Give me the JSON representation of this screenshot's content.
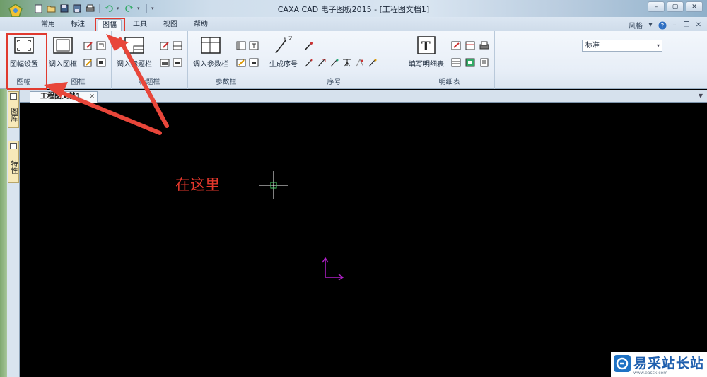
{
  "window": {
    "title": "CAXA CAD 电子图板2015 - [工程图文档1]",
    "style_label": "风格"
  },
  "menu": {
    "tabs": [
      {
        "label": "常用"
      },
      {
        "label": "标注"
      },
      {
        "label": "图幅"
      },
      {
        "label": "工具"
      },
      {
        "label": "视图"
      },
      {
        "label": "帮助"
      }
    ],
    "active_tab": "图幅"
  },
  "ribbon": {
    "frame_group": {
      "label": "图幅",
      "settings_button": "图幅设置"
    },
    "border_group": {
      "label": "图框",
      "load_button": "调入图框"
    },
    "titlebar_group": {
      "label": "标题栏",
      "load_button": "调入标题栏"
    },
    "param_group": {
      "label": "参数栏",
      "load_button": "调入参数栏"
    },
    "number_group": {
      "label": "序号",
      "generate_button": "生成序号",
      "style_value": "标准"
    },
    "bom_group": {
      "label": "明细表",
      "fill_button": "填写明细表"
    }
  },
  "document": {
    "tab_label": "工程图文档1",
    "side_tabs": [
      "图库",
      "特性"
    ]
  },
  "annotation": {
    "text": "在这里",
    "color": "#e4382c"
  },
  "watermark": {
    "name": "易采站长站",
    "url": "www.easck.com"
  },
  "colors": {
    "canvas": "#000000",
    "crosshair": "#ffffff",
    "ucs": "#b020c8",
    "annotation": "#e03a2f"
  }
}
